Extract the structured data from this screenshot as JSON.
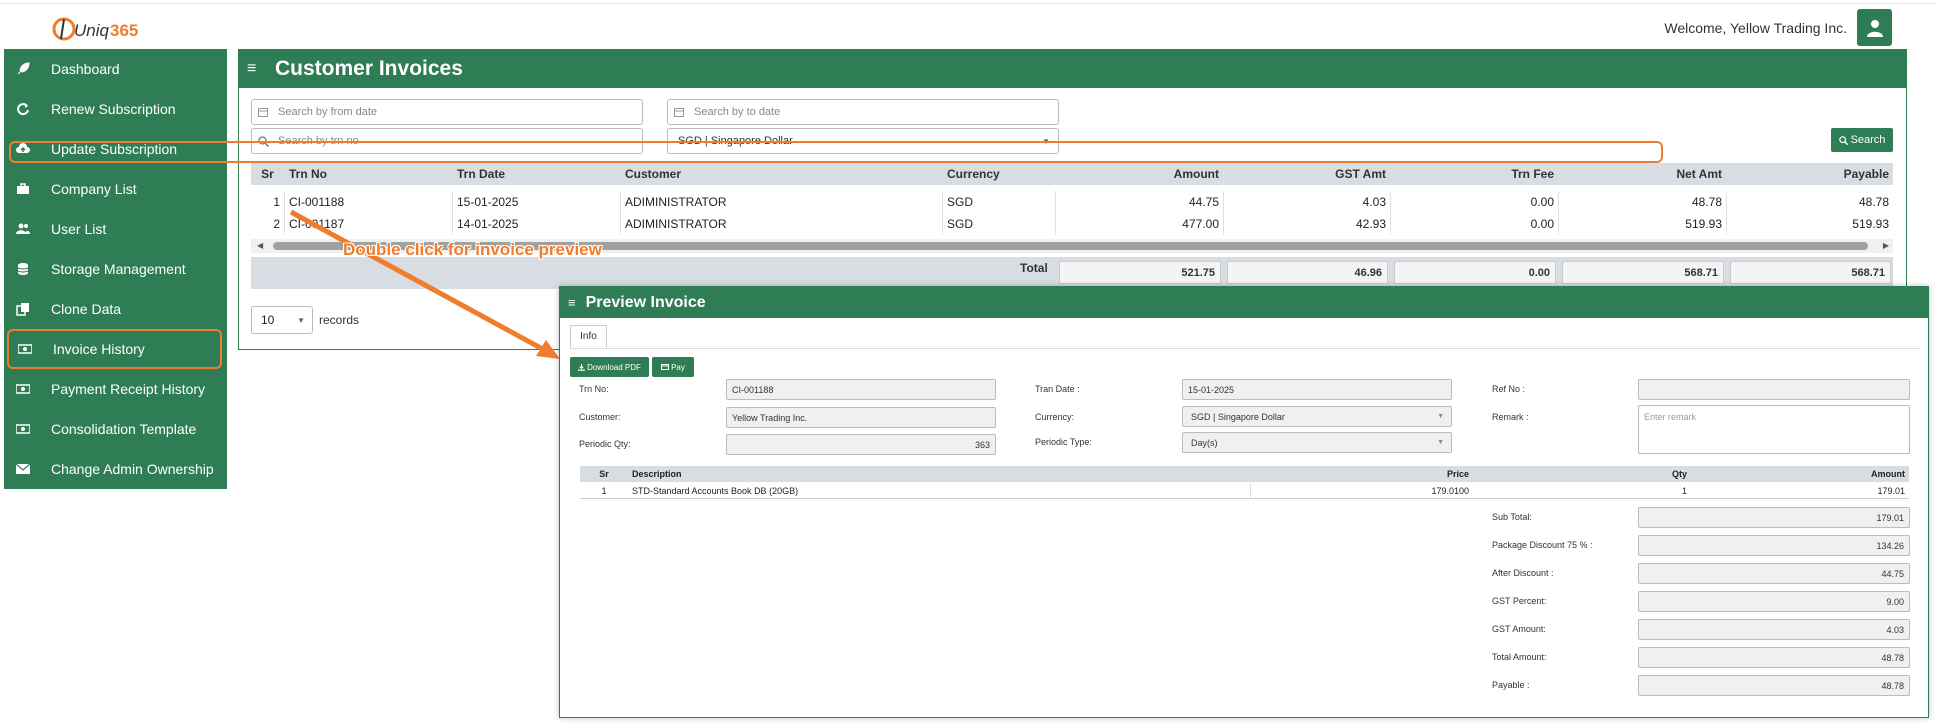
{
  "header": {
    "logo_text": "Uniq365",
    "welcome": "Welcome, Yellow Trading Inc."
  },
  "sidebar": {
    "items": [
      {
        "label": "Dashboard",
        "icon": "rocket-icon"
      },
      {
        "label": "Renew Subscription",
        "icon": "refresh-icon"
      },
      {
        "label": "Update Subscription",
        "icon": "cloud-upload-icon"
      },
      {
        "label": "Company List",
        "icon": "briefcase-icon"
      },
      {
        "label": "User List",
        "icon": "users-icon"
      },
      {
        "label": "Storage Management",
        "icon": "database-icon"
      },
      {
        "label": "Clone Data",
        "icon": "copy-icon"
      },
      {
        "label": "Invoice History",
        "icon": "money-icon",
        "active": true
      },
      {
        "label": "Payment Receipt History",
        "icon": "money-icon"
      },
      {
        "label": "Consolidation Template",
        "icon": "money-icon"
      },
      {
        "label": "Change Admin Ownership",
        "icon": "envelope-icon"
      }
    ]
  },
  "main": {
    "title": "Customer Invoices",
    "filters": {
      "from_date_placeholder": "Search by from date",
      "to_date_placeholder": "Search by to date",
      "trn_no_placeholder": "Search by trn no",
      "currency": "SGD | Singapore Dollar"
    },
    "search_label": "Search",
    "table": {
      "columns": [
        "Sr",
        "Trn No",
        "Trn Date",
        "Customer",
        "Currency",
        "Amount",
        "GST Amt",
        "Trn Fee",
        "Net Amt",
        "Payable"
      ],
      "rows": [
        [
          "1",
          "CI-001188",
          "15-01-2025",
          "ADIMINISTRATOR",
          "SGD",
          "44.75",
          "4.03",
          "0.00",
          "48.78",
          "48.78"
        ],
        [
          "2",
          "CI-001187",
          "14-01-2025",
          "ADIMINISTRATOR",
          "SGD",
          "477.00",
          "42.93",
          "0.00",
          "519.93",
          "519.93"
        ]
      ],
      "total_label": "Total",
      "totals": [
        "521.75",
        "46.96",
        "0.00",
        "568.71",
        "568.71"
      ]
    },
    "page_size": "10",
    "records_label": "records"
  },
  "annotation": {
    "text": "Double click for invoice preview",
    "color": "#f07c2e"
  },
  "preview": {
    "title": "Preview Invoice",
    "tab_info": "Info",
    "download_pdf": "Download PDF",
    "pay": "Pay",
    "fields": {
      "trn_no_label": "Trn No:",
      "trn_no": "CI-001188",
      "tran_date_label": "Tran Date :",
      "tran_date": "15-01-2025",
      "ref_no_label": "Ref No :",
      "ref_no": "",
      "customer_label": "Customer:",
      "customer": "Yellow Trading Inc.",
      "currency_label": "Currency:",
      "currency": "SGD | Singapore Dollar",
      "remark_label": "Remark :",
      "remark_placeholder": "Enter remark",
      "periodic_qty_label": "Periodic Qty:",
      "periodic_qty": "363",
      "periodic_type_label": "Periodic Type:",
      "periodic_type": "Day(s)"
    },
    "items": {
      "columns": [
        "Sr",
        "Description",
        "Price",
        "Qty",
        "Amount"
      ],
      "rows": [
        [
          "1",
          "STD-Standard Accounts Book DB (20GB)",
          "179.0100",
          "1",
          "179.01"
        ]
      ]
    },
    "summary": [
      {
        "label": "Sub Total:",
        "value": "179.01"
      },
      {
        "label": "Package Discount 75 % :",
        "value": "134.26"
      },
      {
        "label": "After Discount :",
        "value": "44.75"
      },
      {
        "label": "GST Percent:",
        "value": "9.00"
      },
      {
        "label": "GST Amount:",
        "value": "4.03"
      },
      {
        "label": "Total Amount:",
        "value": "48.78"
      },
      {
        "label": "Payable :",
        "value": "48.78"
      }
    ]
  },
  "colors": {
    "brand_green": "#2e7d55",
    "highlight_orange": "#f07c2e",
    "table_header": "#d8dde3"
  }
}
